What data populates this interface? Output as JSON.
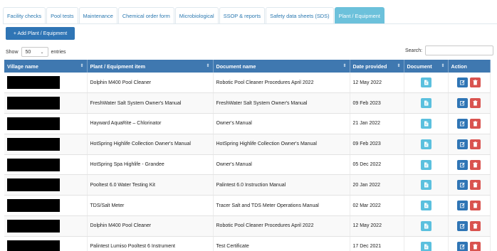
{
  "tabs": [
    {
      "label": "Facility checks",
      "active": false
    },
    {
      "label": "Pool tests",
      "active": false
    },
    {
      "label": "Maintenance",
      "active": false
    },
    {
      "label": "Chemical order form",
      "active": false
    },
    {
      "label": "Microbiological",
      "active": false
    },
    {
      "label": "SSOP & reports",
      "active": false
    },
    {
      "label": "Safety data sheets (SDS)",
      "active": false
    },
    {
      "label": "Plant / Equipment",
      "active": true
    }
  ],
  "add_button": {
    "label": "+ Add Plant / Equipment"
  },
  "length_control": {
    "show_label": "Show",
    "value": "50",
    "entries_label": "entries"
  },
  "search": {
    "label": "Search:",
    "value": ""
  },
  "table": {
    "headers": [
      "Village name",
      "Plant / Equipment item",
      "Document name",
      "Date provided",
      "Document",
      "Action"
    ],
    "rows": [
      {
        "village": "",
        "item": "Dolphin M400 Pool Cleaner",
        "document": "Robotic Pool Cleaner Procedures April 2022",
        "date": "12 May 2022"
      },
      {
        "village": "",
        "item": "FreshWater Salt System Owner's Manual",
        "document": "FreshWater Salt System Owner's Manual",
        "date": "09 Feb 2023"
      },
      {
        "village": "",
        "item": "Hayward AquaRite – Chlorinator",
        "document": "Owner's Manual",
        "date": "21 Jan 2022"
      },
      {
        "village": "",
        "item": "HotSpring Highlife Collection Owner's Manual",
        "document": "HotSpring Highlife Collection Owner's Manual",
        "date": "09 Feb 2023"
      },
      {
        "village": "",
        "item": "HotSpring Spa Highlife - Grandee",
        "document": "Owner's Manual",
        "date": "05 Dec 2022"
      },
      {
        "village": "",
        "item": "Pooltest 6.0 Water Testing Kit",
        "document": "Palintest 6.0 Instruction Manual",
        "date": "20 Jan 2022"
      },
      {
        "village": "",
        "item": "TDS/Salt Meter",
        "document": "Tracer Salt and TDS Meter Operations Manual",
        "date": "02 Mar 2022"
      },
      {
        "village": "",
        "item": "Dolphin M400 Pool Cleaner",
        "document": "Robotic Pool Cleaner Procedures April 2022",
        "date": "12 May 2022"
      },
      {
        "village": "",
        "item": "Palintest Lumiso Pooltest 6 Instrument",
        "document": "Test Certificate",
        "date": "17 Dec 2021"
      }
    ]
  },
  "colors": {
    "header_bg": "#3f78b0",
    "active_tab": "#6cc1db",
    "doc_btn": "#5bc0de",
    "edit_btn": "#2f75b5",
    "delete_btn": "#d9534f"
  },
  "icons": {
    "document": "file-icon",
    "edit": "edit-icon",
    "delete": "trash-icon",
    "sort": "sort-icon"
  }
}
